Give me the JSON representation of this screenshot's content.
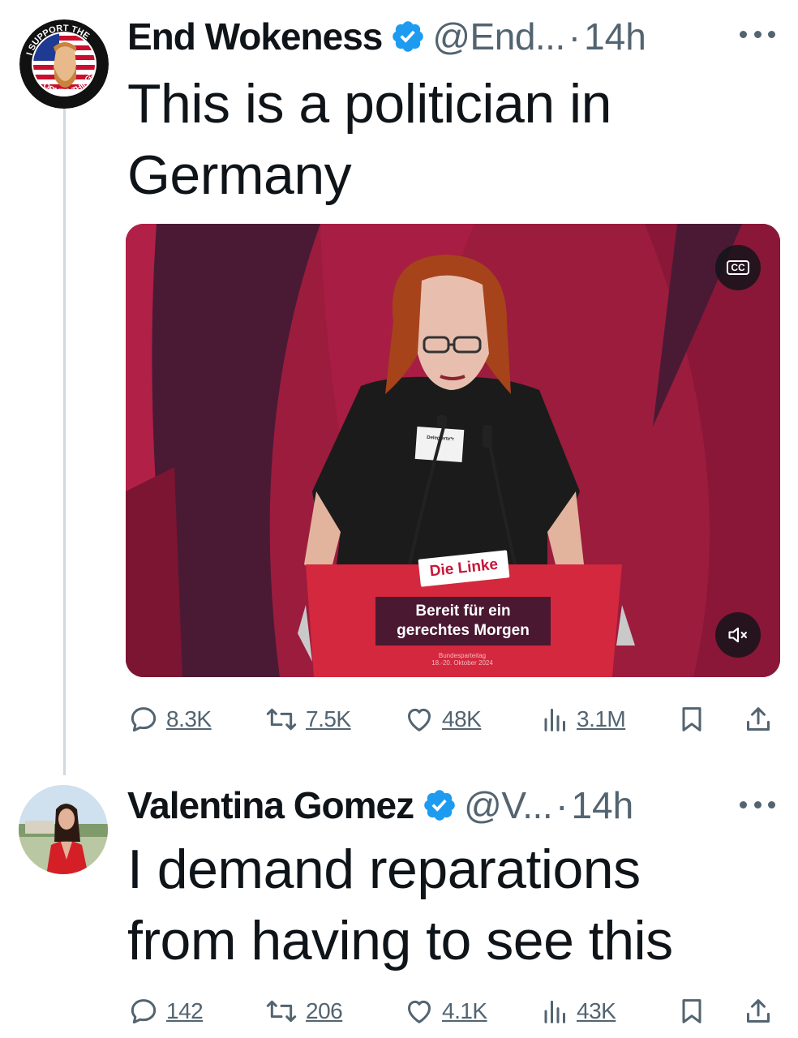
{
  "tweets": [
    {
      "author": {
        "name": "End Wokeness",
        "handle": "@End...",
        "avatar_text_top": "I SUPPORT THE",
        "avatar_text_bottom": "FORMER THINGS"
      },
      "separator": "·",
      "time": "14h",
      "text_lines": [
        "This is a politician in",
        "Germany"
      ],
      "media": {
        "podium_logo": "Die Linke",
        "podium_slogan_lines": [
          "Bereit für ein",
          "gerechtes Morgen"
        ],
        "podium_event_lines": [
          "Bundesparteitag",
          "18.-20. Oktober 2024"
        ],
        "badge_text": "Delegierte*r",
        "cc_label": "CC"
      },
      "stats": {
        "replies": "8.3K",
        "reposts": "7.5K",
        "likes": "48K",
        "views": "3.1M"
      }
    },
    {
      "author": {
        "name": "Valentina Gomez",
        "handle": "@V..."
      },
      "separator": "·",
      "time": "14h",
      "text_lines": [
        "I demand reparations",
        "from having to see this"
      ],
      "stats": {
        "replies": "142",
        "reposts": "206",
        "likes": "4.1K",
        "views": "43K"
      }
    }
  ],
  "colors": {
    "verified_badge": "#1d9bf0",
    "text_primary": "#0f1419",
    "text_secondary": "#536471",
    "thread_line": "#cfd9de",
    "stage_red": "#a31a3e",
    "podium_red": "#d62a3a"
  },
  "icons": [
    "verified-icon",
    "more-icon",
    "reply-icon",
    "repost-icon",
    "like-icon",
    "views-icon",
    "bookmark-icon",
    "share-icon",
    "cc-icon",
    "mute-icon"
  ]
}
